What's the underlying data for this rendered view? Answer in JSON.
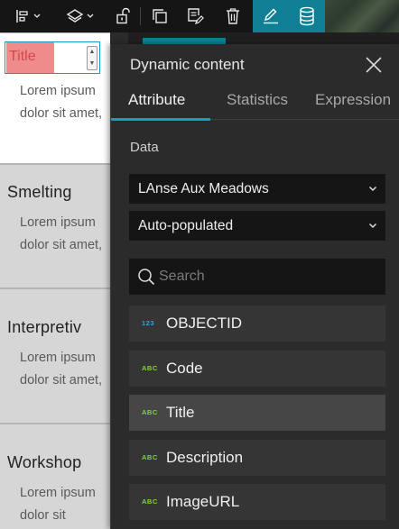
{
  "toolbar": {
    "icons": [
      "align-icon",
      "layers-icon",
      "unlock-icon",
      "duplicate-icon",
      "edit-document-icon",
      "delete-icon",
      "pencil-icon",
      "database-icon"
    ]
  },
  "cards": [
    {
      "title": "Title",
      "text": "Lorem ipsum dolor sit amet,"
    },
    {
      "title": "Smelting",
      "text": "Lorem ipsum dolor sit amet,"
    },
    {
      "title": "Interpretiv",
      "text": "Lorem ipsum dolor sit amet,"
    },
    {
      "title": "Workshop",
      "text": "Lorem ipsum dolor sit"
    }
  ],
  "panel": {
    "title": "Dynamic content",
    "tabs": [
      {
        "label": "Attribute",
        "active": true
      },
      {
        "label": "Statistics",
        "active": false
      },
      {
        "label": "Expression",
        "active": false
      }
    ],
    "data_label": "Data",
    "layer_select": "LAnse Aux Meadows",
    "mode_select": "Auto-populated",
    "search_placeholder": "Search",
    "fields": [
      {
        "type": "123",
        "name": "OBJECTID"
      },
      {
        "type": "ABC",
        "name": "Code"
      },
      {
        "type": "ABC",
        "name": "Title"
      },
      {
        "type": "ABC",
        "name": "Description"
      },
      {
        "type": "ABC",
        "name": "ImageURL"
      }
    ]
  },
  "colors": {
    "accent": "#1a9bbf",
    "active_toolbar": "#0f7f96",
    "panel_bg": "#2b2b2b",
    "number_type": "#34a3d8",
    "string_type": "#7fd43f",
    "highlight": "#f08b8b"
  }
}
